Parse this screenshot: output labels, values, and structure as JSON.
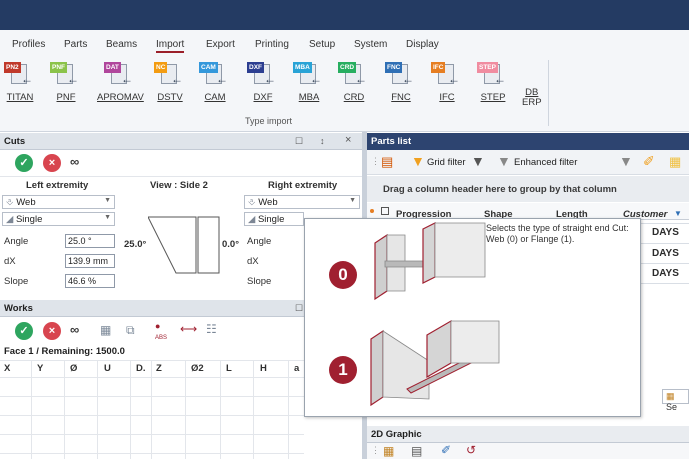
{
  "menu": {
    "items": [
      "Profiles",
      "Parts",
      "Beams",
      "Import",
      "Export",
      "Printing",
      "Setup",
      "System",
      "Display"
    ],
    "active": "Import"
  },
  "ribbon": {
    "buttons": [
      {
        "tag": "PN2",
        "label": "TITAN",
        "color": "#c0392b"
      },
      {
        "tag": "PNF",
        "label": "PNF",
        "color": "#8bc34a"
      },
      {
        "tag": "DAT",
        "label": "APROMAV",
        "color": "#b0469c"
      },
      {
        "tag": "NC",
        "label": "DSTV",
        "color": "#f39c12"
      },
      {
        "tag": "CAM",
        "label": "CAM",
        "color": "#3498db"
      },
      {
        "tag": "DXF",
        "label": "DXF",
        "color": "#2c3e91"
      },
      {
        "tag": "MBA",
        "label": "MBA",
        "color": "#29a3d6"
      },
      {
        "tag": "CRD",
        "label": "CRD",
        "color": "#27ae60"
      },
      {
        "tag": "FNC",
        "label": "FNC",
        "color": "#2f6fb5"
      },
      {
        "tag": "IFC",
        "label": "IFC",
        "color": "#e67e22"
      },
      {
        "tag": "STEP",
        "label": "STEP",
        "color": "#f08ca0"
      }
    ],
    "db_erp_line1": "DB",
    "db_erp_line2": "ERP",
    "group_label": "Type import"
  },
  "cuts": {
    "title": "Cuts",
    "pin": "☐",
    "tack": "↕",
    "close": "×",
    "left_header": "Left extremity",
    "view_header": "View : Side 2",
    "right_header": "Right extremity",
    "left_type": "Web",
    "left_mode": "Single",
    "right_type": "Web",
    "right_mode": "Single",
    "angle_label": "Angle",
    "dx_label": "dX",
    "slope_label": "Slope",
    "angle_value": "25.0 °",
    "dx_value": "139.9 mm",
    "slope_value": "46.6 %",
    "view_left_angle": "25.0°",
    "view_right_angle": "0.0°"
  },
  "works": {
    "title": "Works",
    "face_status": "Face 1 / Remaining: 1500.0",
    "columns": [
      "X",
      "Y",
      "Ø",
      "U",
      "D.",
      "Z",
      "Ø2",
      "L",
      "H",
      "a"
    ]
  },
  "parts_list": {
    "title": "Parts list",
    "grid_filter": "Grid filter",
    "enhanced_filter": "Enhanced filter",
    "group_hint": "Drag a column header here to group by that column",
    "columns": [
      "Progression",
      "Shape",
      "Length",
      "Customer"
    ],
    "rows": [
      "DAYS",
      "DAYS",
      "DAYS"
    ]
  },
  "graphic": {
    "title": "2D Graphic"
  },
  "tooltip": {
    "text": "Selects the type of straight end Cut: Web (0) or Flange (1).",
    "badge0": "0",
    "badge1": "1"
  },
  "colors": {
    "titlebar": "#243b63",
    "accent": "#9b1f2a",
    "badge": "#a02030"
  }
}
